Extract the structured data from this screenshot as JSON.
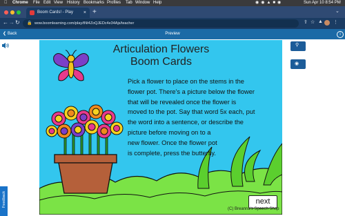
{
  "menubar": {
    "app": "Chrome",
    "items": [
      "File",
      "Edit",
      "View",
      "History",
      "Bookmarks",
      "Profiles",
      "Tab",
      "Window",
      "Help"
    ],
    "clock": "Sun Apr 10  8:54 PM"
  },
  "browser": {
    "tab_title": "Boom Cards! - Play",
    "url": "wow.boomlearning.com/play/tNt4ZoQJEDc4e34Ajs/teacher"
  },
  "appbar": {
    "back_label": "Back",
    "title": "Preview"
  },
  "side_buttons": {
    "overview": "Overview",
    "hide_card": "Hide Card"
  },
  "feedback_label": "Feedback",
  "card": {
    "title_line1": "Articulation Flowers",
    "title_line2": "Boom Cards",
    "body_lines": [
      "Pick a flower to place on the stems in the",
      "flower pot. There's a picture below the flower",
      "that will be revealed once the flower is",
      "moved to the pot. Say that word 5x each, put",
      "the word into a sentence, or describe the",
      "picture before moving on to a",
      "new flower. Once the flower pot",
      "is complete, press the butterfly."
    ],
    "next_label": "next",
    "credit": "(C) Breanna's Speech Shop"
  },
  "colors": {
    "card_bg": "#33c6ee",
    "grass": "#7be346",
    "pot": "#b5603a",
    "appbar": "#1b6aa6"
  }
}
